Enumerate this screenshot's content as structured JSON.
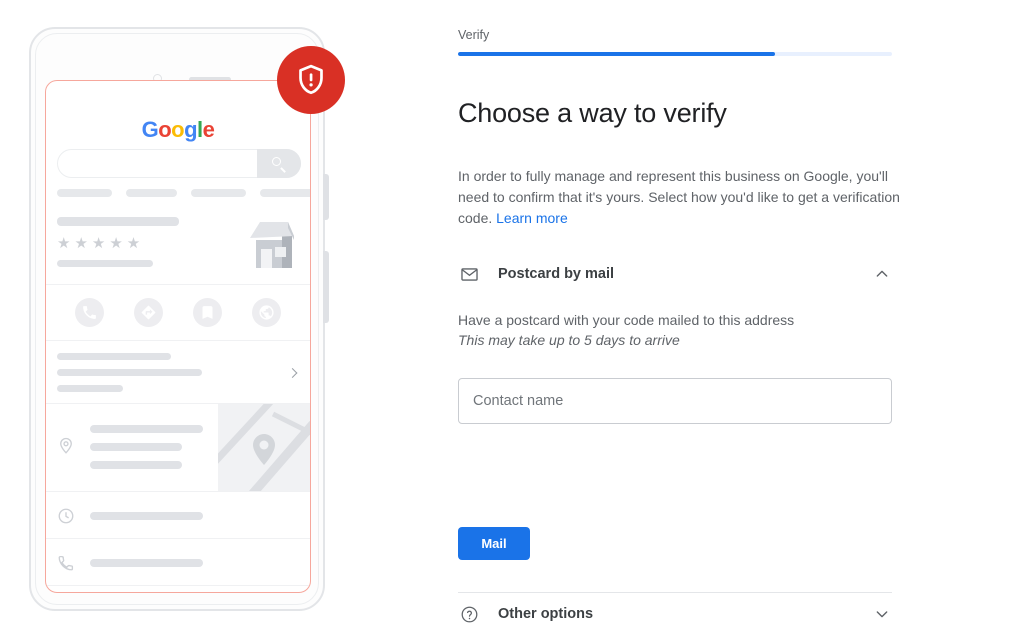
{
  "progress": {
    "step_label": "Verify",
    "percent": 73,
    "fill_color": "#1a73e8",
    "track_color": "#e8f0fe"
  },
  "form": {
    "headline": "Choose a way to verify",
    "body_text": "In order to fully manage and represent this business on Google, you'll need to confirm that it's yours. Select how you'd like to get a verification code. ",
    "learn_more_label": "Learn more",
    "option": {
      "icon": "envelope-icon",
      "title": "Postcard by mail",
      "chevron": "chevron-up-icon",
      "description": "Have a postcard with your code mailed to this address",
      "subnote": "This may take up to 5 days to arrive"
    },
    "contact_field": {
      "placeholder": "Contact name",
      "value": ""
    },
    "submit_label": "Mail",
    "other_options": {
      "icon": "help-circle-icon",
      "label": "Other options",
      "chevron": "chevron-down-icon"
    }
  },
  "illustration": {
    "badge": {
      "icon": "shield-alert-icon",
      "color": "#d93025"
    },
    "google_logo": {
      "letters": [
        "G",
        "o",
        "o",
        "g",
        "l",
        "e"
      ],
      "colors": [
        "#4285f4",
        "#ea4335",
        "#fbbc05",
        "#4285f4",
        "#34a853",
        "#ea4335"
      ]
    },
    "screen": {
      "search_icon": "search-icon",
      "action_icons": [
        "call-icon",
        "directions-icon",
        "save-icon",
        "share-icon"
      ],
      "info_icons": [
        "location-pin-icon",
        "clock-icon",
        "phone-icon",
        "globe-icon"
      ],
      "rating_stars": 5,
      "storefront_icon": "storefront-icon",
      "map_pin_icon": "map-pin-icon",
      "chevron_right_icon": "chevron-right-icon"
    }
  }
}
